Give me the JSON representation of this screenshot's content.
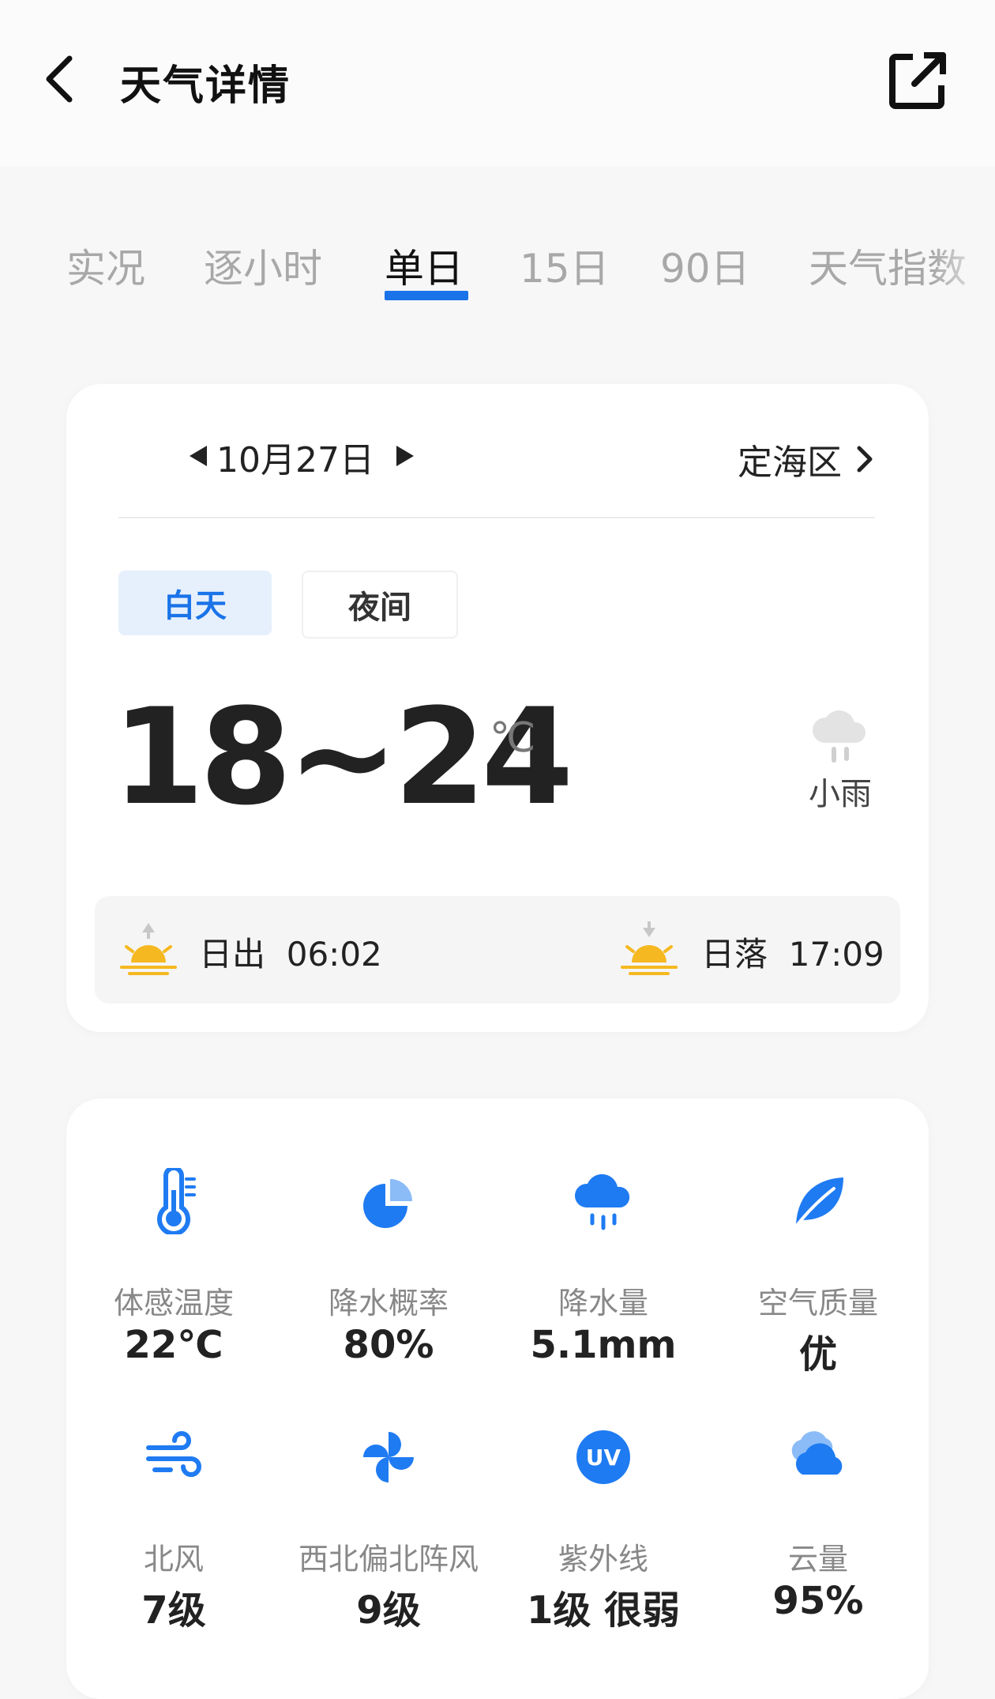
{
  "header": {
    "title": "天气详情",
    "back_icon": "chevron-left-icon",
    "share_icon": "external-link-icon"
  },
  "tabs": [
    {
      "label": "实况",
      "active": false
    },
    {
      "label": "逐小时",
      "active": false
    },
    {
      "label": "单日",
      "active": true
    },
    {
      "label": "15日",
      "active": false
    },
    {
      "label": "90日",
      "active": false
    },
    {
      "label": "天气指数",
      "active": false
    }
  ],
  "day_card": {
    "date": "10月27日",
    "location": "定海区",
    "toggle": {
      "day": "白天",
      "night": "夜间",
      "selected": "day"
    },
    "temp_range": "18~24",
    "temp_unit": "℃",
    "condition": "小雨",
    "condition_icon": "light-rain-icon",
    "sunrise": {
      "label": "日出",
      "time": "06:02"
    },
    "sunset": {
      "label": "日落",
      "time": "17:09"
    }
  },
  "metrics": [
    {
      "label": "体感温度",
      "value": "22℃",
      "icon": "thermometer-icon"
    },
    {
      "label": "降水概率",
      "value": "80%",
      "icon": "pie-chart-icon"
    },
    {
      "label": "降水量",
      "value": "5.1mm",
      "icon": "rain-cloud-icon"
    },
    {
      "label": "空气质量",
      "value": "优",
      "icon": "leaf-icon"
    },
    {
      "label": "北风",
      "value": "7级",
      "icon": "wind-icon"
    },
    {
      "label": "西北偏北阵风",
      "value": "9级",
      "icon": "pinwheel-icon"
    },
    {
      "label": "紫外线",
      "value": "1级 很弱",
      "icon": "uv-icon"
    },
    {
      "label": "云量",
      "value": "95%",
      "icon": "cloud-icon"
    }
  ],
  "colors": {
    "accent": "#1a73e8",
    "sun": "#f5b820",
    "icon_blue": "#1f7bf2"
  }
}
